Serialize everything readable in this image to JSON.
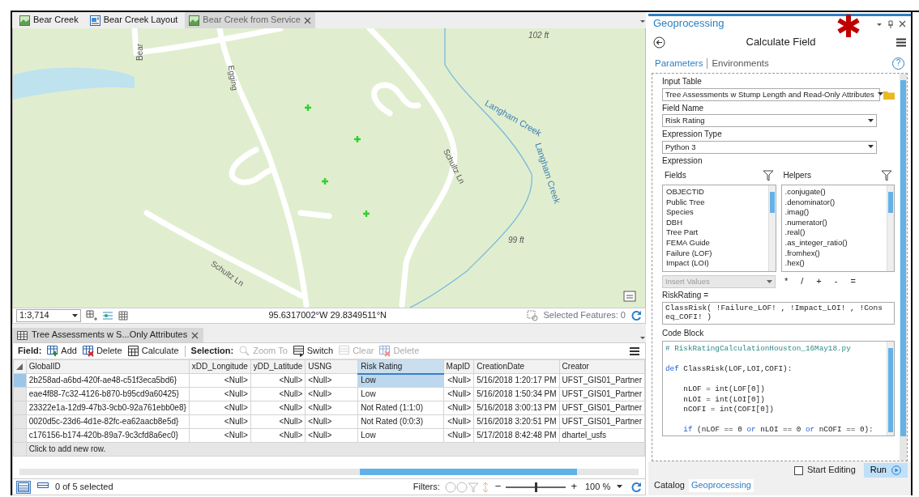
{
  "map_tabs": [
    {
      "label": "Bear Creek",
      "kind": "map",
      "selected": false
    },
    {
      "label": "Bear Creek Layout",
      "kind": "layout",
      "selected": false
    },
    {
      "label": "Bear Creek from Service",
      "kind": "map",
      "selected": true
    }
  ],
  "map": {
    "labels": [
      {
        "text": "Bear",
        "kind": "road"
      },
      {
        "text": "Egging",
        "kind": "road"
      },
      {
        "text": "Schultz Ln",
        "kind": "road"
      },
      {
        "text": "Schultz Ln",
        "kind": "road"
      },
      {
        "text": "Langham Creek",
        "kind": "water"
      },
      {
        "text": "Langham Creek",
        "kind": "water"
      },
      {
        "text": "99 ft",
        "kind": "elevation"
      },
      {
        "text": "102 ft",
        "kind": "elevation"
      }
    ]
  },
  "map_status": {
    "scale": "1:3,714",
    "coordinates": "95.6317002°W 29.8349511°N",
    "selected_features": "Selected Features: 0"
  },
  "table_tab": {
    "label": "Tree Assessments w S...Only Attributes"
  },
  "table_toolbar": {
    "field_label": "Field:",
    "field_buttons": [
      {
        "label": "Add",
        "kind": "add",
        "disabled": false
      },
      {
        "label": "Delete",
        "kind": "delete",
        "disabled": false
      },
      {
        "label": "Calculate",
        "kind": "calculate",
        "disabled": false
      }
    ],
    "selection_label": "Selection:",
    "selection_buttons": [
      {
        "label": "Zoom To",
        "kind": "zoom",
        "disabled": true
      },
      {
        "label": "Switch",
        "kind": "switch",
        "disabled": false
      },
      {
        "label": "Clear",
        "kind": "clear",
        "disabled": true
      },
      {
        "label": "Delete",
        "kind": "delete",
        "disabled": true
      }
    ]
  },
  "table": {
    "columns": [
      {
        "label": "GlobalID",
        "kind": "text",
        "selected": false
      },
      {
        "label": "xDD_Longitude",
        "kind": "number",
        "selected": false
      },
      {
        "label": "yDD_Latitude",
        "kind": "number",
        "selected": false
      },
      {
        "label": "USNG",
        "kind": "text",
        "selected": false
      },
      {
        "label": "Risk Rating",
        "kind": "text",
        "selected": true
      },
      {
        "label": "MapID",
        "kind": "number",
        "selected": false
      },
      {
        "label": "CreationDate",
        "kind": "text",
        "selected": false
      },
      {
        "label": "Creator",
        "kind": "text",
        "selected": false
      }
    ],
    "rows": [
      {
        "current": true,
        "cells": [
          "2b258ad-a6bd-420f-ae48-c51f3eca5bd6}",
          "<Null>",
          "<Null>",
          "<Null>",
          "Low",
          "<Null>",
          "5/16/2018 1:20:17 PM",
          "UFST_GIS01_Partner"
        ]
      },
      {
        "current": false,
        "cells": [
          "eae4f88-7c32-4126-b870-b95cd9a60425}",
          "<Null>",
          "<Null>",
          "<Null>",
          "Low",
          "<Null>",
          "5/16/2018 1:50:34 PM",
          "UFST_GIS01_Partner"
        ]
      },
      {
        "current": false,
        "cells": [
          "23322e1a-12d9-47b3-9cb0-92a761ebb0e8}",
          "<Null>",
          "<Null>",
          "<Null>",
          "Not Rated (1:1:0)",
          "<Null>",
          "5/16/2018 3:00:13 PM",
          "UFST_GIS01_Partner"
        ]
      },
      {
        "current": false,
        "cells": [
          "0020d5c-23d6-4d1e-82fc-ea62aacb8e5d}",
          "<Null>",
          "<Null>",
          "<Null>",
          "Not Rated (0:0:3)",
          "<Null>",
          "5/16/2018 3:20:51 PM",
          "UFST_GIS01_Partner"
        ]
      },
      {
        "current": false,
        "cells": [
          "c176156-b174-420b-89a7-9c3cfd8a6ec0}",
          "<Null>",
          "<Null>",
          "<Null>",
          "Low",
          "<Null>",
          "5/17/2018 8:42:48 PM",
          "dhartel_usfs"
        ]
      }
    ],
    "add_row": "Click to add new row."
  },
  "table_status": {
    "views": [
      {
        "kind": "table",
        "selected": true
      },
      {
        "kind": "list",
        "selected": false
      }
    ],
    "selection": "0 of 5 selected",
    "filters_label": "Filters:",
    "zoom_out": "−",
    "zoom_in": "+",
    "zoom": {
      "level": 0.5,
      "value": "100 %"
    }
  },
  "panel": {
    "title": "Geoprocessing",
    "tool": "Calculate Field",
    "help": "?",
    "tabs": [
      {
        "label": "Parameters",
        "selected": true
      },
      {
        "label": "Environments",
        "selected": false
      }
    ],
    "input_table": {
      "label": "Input Table",
      "value": "Tree Assessments w Stump Length and Read-Only Attributes"
    },
    "field_name": {
      "label": "Field Name",
      "value": "Risk Rating"
    },
    "expression_type": {
      "label": "Expression Type",
      "value": "Python 3"
    },
    "expression_label": "Expression",
    "fields": {
      "label": "Fields",
      "items": [
        "OBJECTID",
        "Public Tree",
        "Species",
        "DBH",
        "Tree Part",
        "FEMA Guide",
        "Failure (LOF)",
        "Impact (LOI)"
      ]
    },
    "helpers": {
      "label": "Helpers",
      "items": [
        ".conjugate()",
        ".denominator()",
        ".imag()",
        ".numerator()",
        ".real()",
        ".as_integer_ratio()",
        ".fromhex()",
        ".hex()"
      ]
    },
    "insert_values": {
      "placeholder": "Insert Values",
      "disabled": true
    },
    "operators": [
      "*",
      "/",
      "+",
      "-",
      "="
    ],
    "expression": {
      "label": "RiskRating =",
      "value": "ClassRisk( !Failure_LOF! , !Impact_LOI! , !Conseq_COFI! )"
    },
    "code_block": {
      "label": "Code Block",
      "lines": [
        {
          "kind": "code",
          "segments": [
            {
              "text": "# RiskRatingCalculationHouston_16May18.py",
              "kind": "comment"
            }
          ]
        },
        {
          "kind": "blank"
        },
        {
          "kind": "code",
          "segments": [
            {
              "text": "def",
              "kind": "keyword"
            },
            {
              "text": " ClassRisk(LOF,LOI,COFI):",
              "kind": "plain"
            }
          ]
        },
        {
          "kind": "blank"
        },
        {
          "kind": "code",
          "segments": [
            {
              "text": "    nLOF = int(LOF[0])",
              "kind": "plain"
            }
          ]
        },
        {
          "kind": "code",
          "segments": [
            {
              "text": "    nLOI = int(LOI[0])",
              "kind": "plain"
            }
          ]
        },
        {
          "kind": "code",
          "segments": [
            {
              "text": "    nCOFI = int(COFI[0])",
              "kind": "plain"
            }
          ]
        },
        {
          "kind": "blank"
        },
        {
          "kind": "code",
          "segments": [
            {
              "text": "    if",
              "kind": "keyword"
            },
            {
              "text": " (nLOF == 0 ",
              "kind": "plain"
            },
            {
              "text": "or",
              "kind": "keyword"
            },
            {
              "text": " nLOI == 0 ",
              "kind": "plain"
            },
            {
              "text": "or",
              "kind": "keyword"
            },
            {
              "text": " nCOFI == 0):",
              "kind": "plain"
            }
          ]
        }
      ]
    },
    "start_editing": {
      "label": "Start Editing",
      "checked": false
    },
    "run": "Run",
    "bottom_tabs": [
      {
        "label": "Catalog",
        "selected": false
      },
      {
        "label": "Geoprocessing",
        "selected": true
      }
    ]
  }
}
